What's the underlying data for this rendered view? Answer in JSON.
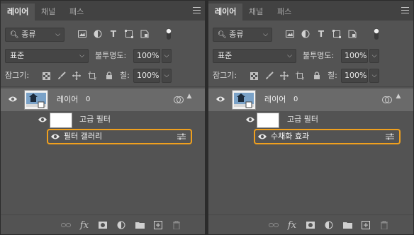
{
  "panels": [
    {
      "tabs": [
        "레이어",
        "채널",
        "패스"
      ],
      "filter_kind": "종류",
      "blend_mode": "표준",
      "opacity_label": "불투명도:",
      "opacity_value": "100%",
      "lock_label": "잠그기:",
      "fill_label": "칠:",
      "fill_value": "100%",
      "layer_name": "레이어",
      "layer_index": "0",
      "smart_filter_label": "고급 필터",
      "filter_name": "필터 갤러리"
    },
    {
      "tabs": [
        "레이어",
        "채널",
        "패스"
      ],
      "filter_kind": "종류",
      "blend_mode": "표준",
      "opacity_label": "불투명도:",
      "opacity_value": "100%",
      "lock_label": "잠그기:",
      "fill_label": "칠:",
      "fill_value": "100%",
      "layer_name": "레이어",
      "layer_index": "0",
      "smart_filter_label": "고급 필터",
      "filter_name": "수채화 효과"
    }
  ],
  "footer_icons": [
    "link-icon",
    "fx-icon",
    "mask-icon",
    "adjustment-icon",
    "folder-icon",
    "new-layer-icon",
    "trash-icon"
  ],
  "colors": {
    "panel": "#535353",
    "selected_layer": "#6a6a6a",
    "highlight": "#f0a01e"
  }
}
